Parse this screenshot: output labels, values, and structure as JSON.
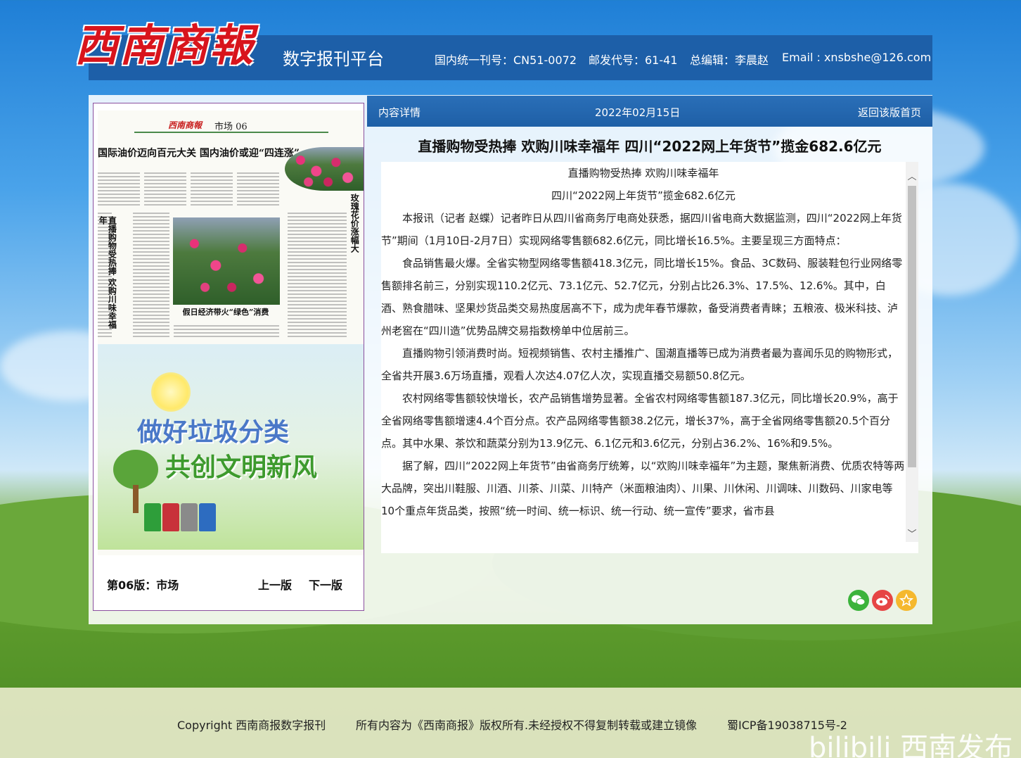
{
  "header": {
    "logo_text": "西南商報",
    "platform": "数字报刊平台",
    "issn": "国内统一刊号：CN51-0072",
    "postal": "邮发代号：61-41",
    "editor": "总编辑：李晨赵",
    "email": "Email : xnsbshe@126.com"
  },
  "newspaper_preview": {
    "logo": "西南商報",
    "section": "市场 06",
    "headline": "国际油价迈向百元大关 国内油价或迎“四连涨”",
    "vertical_headline_1": "直播购物受热捧 欢购川味幸福年",
    "vertical_headline_2": "玫瑰花价涨幅大",
    "photo_caption": "假日经济带火“绿色”消费",
    "promo_line1": "做好垃圾分类",
    "promo_line2": "共创文明新风"
  },
  "page_nav": {
    "edition": "第06版：市场",
    "prev": "上一版",
    "next": "下一版"
  },
  "detail_bar": {
    "label": "内容详情",
    "date": "2022年02月15日",
    "back": "返回该版首页"
  },
  "article": {
    "title": "直播购物受热捧 欢购川味幸福年 四川“2022网上年货节”揽金682.6亿元",
    "subtitle1": "直播购物受热捧 欢购川味幸福年",
    "subtitle2": "四川“2022网上年货节”揽金682.6亿元",
    "paragraphs": [
      "本报讯（记者 赵蝶）记者昨日从四川省商务厅电商处获悉，据四川省电商大数据监测，四川“2022网上年货节”期间（1月10日-2月7日）实现网络零售额682.6亿元，同比增长16.5%。主要呈现三方面特点：",
      "食品销售最火爆。全省实物型网络零售额418.3亿元，同比增长15%。食品、3C数码、服装鞋包行业网络零售额排名前三，分别实现110.2亿元、73.1亿元、52.7亿元，分别占比26.3%、17.5%、12.6%。其中，白酒、熟食腊味、坚果炒货品类交易热度居高不下，成为虎年春节爆款，备受消费者青睐；五粮液、极米科技、泸州老窖在“四川造”优势品牌交易指数榜单中位居前三。",
      "直播购物引领消费时尚。短视频销售、农村主播推广、国潮直播等已成为消费者最为喜闻乐见的购物形式，全省共开展3.6万场直播，观看人次达4.07亿人次，实现直播交易额50.8亿元。",
      "农村网络零售额较快增长，农产品销售增势显著。全省农村网络零售额187.3亿元，同比增长20.9%，高于全省网络零售额增速4.4个百分点。农产品网络零售额38.2亿元，增长37%，高于全省网络零售额20.5个百分点。其中水果、茶饮和蔬菜分别为13.9亿元、6.1亿元和3.6亿元，分别占36.2%、16%和9.5%。",
      "据了解，四川“2022网上年货节”由省商务厅统筹，以“欢购川味幸福年”为主题，聚焦新消费、优质农特等两大品牌，突出川鞋服、川酒、川茶、川菜、川特产（米面粮油肉）、川果、川休闲、川调味、川数码、川家电等10个重点年货品类，按照“统一时间、统一标识、统一行动、统一宣传”要求，省市县"
    ]
  },
  "share": {
    "wechat_icon": "wechat-icon",
    "weibo_icon": "weibo-icon",
    "favorite_icon": "star-icon",
    "colors": {
      "wechat": "#3bb33b",
      "weibo": "#e64545",
      "favorite": "#f5b82e"
    }
  },
  "footer": {
    "copyright": "Copyright 西南商报数字报刊",
    "rights": "所有内容为《西南商报》版权所有.未经授权不得复制转载或建立镜像",
    "icp": "蜀ICP备19038715号-2",
    "watermark": "bilibili 西南发布"
  }
}
